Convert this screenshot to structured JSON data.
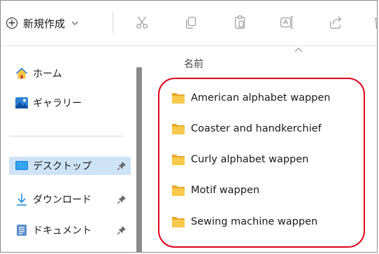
{
  "toolbar": {
    "new_label": "新規作成"
  },
  "sidebar": {
    "top_items": [
      {
        "label": "ホーム",
        "icon": "home-icon"
      },
      {
        "label": "ギャラリー",
        "icon": "gallery-icon"
      }
    ],
    "pinned_items": [
      {
        "label": "デスクトップ",
        "icon": "desktop-icon"
      },
      {
        "label": "ダウンロード",
        "icon": "download-icon"
      },
      {
        "label": "ドキュメント",
        "icon": "document-icon"
      }
    ]
  },
  "main": {
    "column_header": "名前",
    "files": [
      {
        "name": "American alphabet wappen"
      },
      {
        "name": "Coaster and handkerchief"
      },
      {
        "name": "Curly alphabet wappen"
      },
      {
        "name": "Motif wappen"
      },
      {
        "name": "Sewing machine wappen"
      }
    ]
  },
  "colors": {
    "highlight_border": "#e0001b",
    "folder": "#f4c542",
    "selected_bg": "#cfe3f7"
  }
}
